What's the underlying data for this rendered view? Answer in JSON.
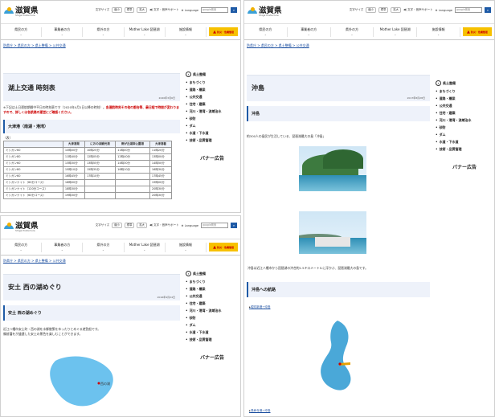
{
  "site": {
    "logo": "滋賀県",
    "logo_sub": "Shiga Prefecture",
    "font_size_label": "文字サイズ",
    "font_shrink": "縮小",
    "font_normal": "標準",
    "font_enlarge": "拡大",
    "voice_support": "文字・音声サポート",
    "language": "Language",
    "search_placeholder": "google検索",
    "search_icon": "search-icon"
  },
  "nav": {
    "items": [
      {
        "label": "県民の方"
      },
      {
        "label": "事業者の方"
      },
      {
        "label": "県外の方"
      },
      {
        "label": "Mother Lake 琵琶湖"
      },
      {
        "label": "施設情報"
      }
    ],
    "disaster": "防災・危機管理"
  },
  "breadcrumb": "防県庁 > 県民の方 > 県土整備 > 公共交通",
  "sidebar": {
    "title": "県土整備",
    "items": [
      "まちづくり",
      "道路・橋梁",
      "公共交通",
      "住宅・建築",
      "河川・港湾・流域治水",
      "砂防",
      "ダム",
      "水道・下水道",
      "技術・品質管理"
    ],
    "banner": "バナー広告"
  },
  "p1": {
    "title": "湖上交通 時刻表",
    "date": "2020年3月6日",
    "notice_a": "※下記は土日運航期間中平日の時刻表です（2020年4月1日以降の時刻）。",
    "notice_b": "各運航時刻その他の都合等、最日程で時間が変わりますので、詳しくは各航路の運営にご確認ください。",
    "section": "大津港（南湖・港湾）",
    "table_caption": "（表）",
    "table_headers": [
      "",
      "大津港発",
      "におの浜観光港",
      "雨が丘湖岸公園港",
      "大津港着"
    ],
    "table_rows": [
      [
        "ミシガン60",
        "10時00分",
        "10時25分",
        "11時00分",
        "11時20分"
      ],
      [
        "ミシガン80",
        "11時40分",
        "12時05分",
        "12時40分",
        "13時00分"
      ],
      [
        "ミシガン60",
        "13時30分",
        "13時55分",
        "14時30分",
        "14時50分"
      ],
      [
        "ミシガン80",
        "15時10分",
        "15時35分",
        "16時10分",
        "16時30分"
      ],
      [
        "ミシガン60",
        "16時45分",
        "17時10分",
        "",
        "17時45分"
      ],
      [
        "ミシガンナイト（60分コース）",
        "18時00分",
        "",
        "",
        "19時00分"
      ],
      [
        "ミシガンナイト（120分コース）",
        "18時30分",
        "",
        "",
        "20時30分"
      ],
      [
        "ミシガンナイト（60分コース）",
        "19時30分",
        "",
        "",
        "20時30分"
      ]
    ]
  },
  "p2": {
    "title": "沖島",
    "date": "2017年8月28日",
    "section": "沖島",
    "desc": "約300人の島民が生活している、琵琶湖最大の島「沖島」",
    "desc2": "沖島は近江八幡市から琵琶湖の沖合約1.5キロメートルに浮かぶ、琵琶湖最大の島です。",
    "route_title": "沖島への航路",
    "route_link": "堀切新港→沖島",
    "route_link2": "長命寺港→沖島"
  },
  "p3": {
    "title": "安土 西の湖めぐり",
    "date": "2016年4月24日",
    "section": "安土 西の湖めぐり",
    "desc": "近江八幡市安土町・西の湖を水郷散策をゆったりとめぐる遊覧船です。",
    "desc2": "備前藩をが盛建した安土の景色を楽しむことができます。",
    "map_label": "西の湖"
  },
  "colors": {
    "accent": "#1e5aa6",
    "heading_bg": "#eef2fa",
    "disaster": "#f7c100",
    "notice": "#cc0000"
  }
}
